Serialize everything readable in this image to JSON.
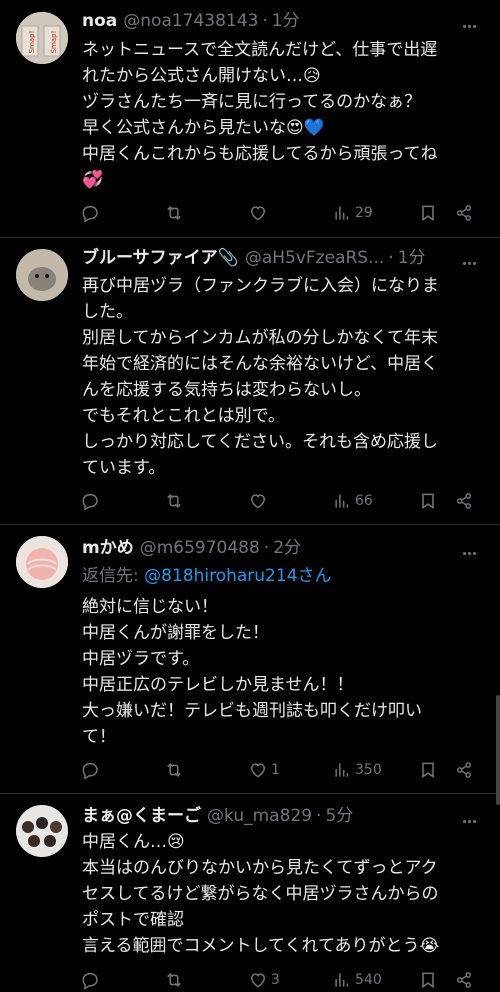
{
  "posts": [
    {
      "name": "noa",
      "handle": "@noa17438143",
      "time": "1分",
      "lines": [
        "ネットニュースで全文読んだけど、仕事で出遅",
        "れたから公式さん開けない…😥",
        "ヅラさんたち一斉に見に行ってるのかなぁ？",
        "早く公式さんから見たいな😍💙",
        "中居くんこれからも応援してるから頑張ってね",
        "💞"
      ],
      "replies": "",
      "likes": "",
      "views": "29"
    },
    {
      "name": "ブルーサファイア📎",
      "handle": "@aH5vFzeaRS...",
      "time": "1分",
      "lines": [
        "再び中居ヅラ（ファンクラブに入会）になりま",
        "した。",
        "別居してからインカムが私の分しかなくて年末",
        "年始で経済的にはそんな余裕ないけど、中居く",
        "んを応援する気持ちは変わらないし。",
        "でもそれとこれとは別で。",
        "しっかり対応してください。それも含め応援し",
        "ています。"
      ],
      "replies": "",
      "likes": "",
      "views": "66"
    },
    {
      "name": "mかめ",
      "handle": "@m65970488",
      "time": "2分",
      "reply_prefix": "返信先: ",
      "reply_to": "@818hiroharu214さん",
      "lines": [
        "絶対に信じない！",
        "中居くんが謝罪をした！",
        "中居ヅラです。",
        "中居正広のテレビしか見ません！！",
        "大っ嫌いだ！テレビも週刊誌も叩くだけ叩い",
        "て！"
      ],
      "replies": "",
      "likes": "1",
      "views": "350"
    },
    {
      "name": "まぁ@くまーご",
      "handle": "@ku_ma829",
      "time": "5分",
      "lines": [
        "中居くん…😢",
        "本当はのんびりなかいから見たくてずっとアク",
        "セスしてるけど繋がらなく中居ヅラさんからの",
        "ポストで確認",
        "言える範囲でコメントしてくれてありがとう😭"
      ],
      "replies": "",
      "likes": "3",
      "views": "540"
    }
  ],
  "icons": [
    "reply-icon",
    "repost-icon",
    "like-icon",
    "views-icon",
    "bookmark-icon",
    "share-icon",
    "more-icon"
  ],
  "colors": {
    "background": "#000000",
    "text": "#e7e9ea",
    "muted": "#71767b",
    "link": "#1d9bf0",
    "divider": "#2f3336"
  }
}
